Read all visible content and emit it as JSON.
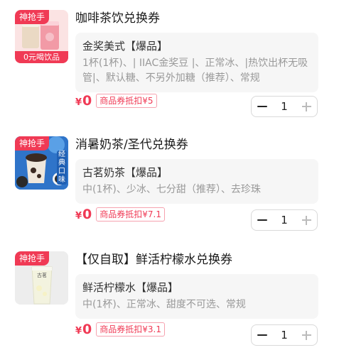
{
  "items": [
    {
      "tag": "神抢手",
      "thumb_caption": "0元喝饮品",
      "title": "咖啡茶饮兑换券",
      "spec_name": "金奖美式【爆品】",
      "spec_desc": "1杯(1杯)、| IIAC金奖豆 |、正常冰、|热饮出杯无吸管|、默认糖、不另外加糖（推荐）、常规",
      "currency": "¥",
      "price": "0",
      "coupon": "商品券抵扣¥5",
      "qty": "1"
    },
    {
      "tag": "神抢手",
      "thumb_caption": "经典口味",
      "title": "消暑奶茶/圣代兑换券",
      "spec_name": "古茗奶茶【爆品】",
      "spec_desc": "中(1杯)、少冰、七分甜（推荐）、去珍珠",
      "currency": "¥",
      "price": "0",
      "coupon": "商品券抵扣¥7.1",
      "qty": "1"
    },
    {
      "tag": "神抢手",
      "thumb_caption": "古茗",
      "title": "【仅自取】鲜活柠檬水兑换券",
      "spec_name": "鲜活柠檬水【爆品】",
      "spec_desc": "中(1杯)、正常冰、甜度不可选、常规",
      "currency": "¥",
      "price": "0",
      "coupon": "商品券抵扣¥3.1",
      "qty": "1"
    }
  ],
  "icons": {
    "minus": "minus-icon",
    "plus": "plus-icon"
  },
  "colors": {
    "accent": "#f03a55",
    "spec_bg": "#f6f6f6",
    "muted_text": "#999999"
  }
}
